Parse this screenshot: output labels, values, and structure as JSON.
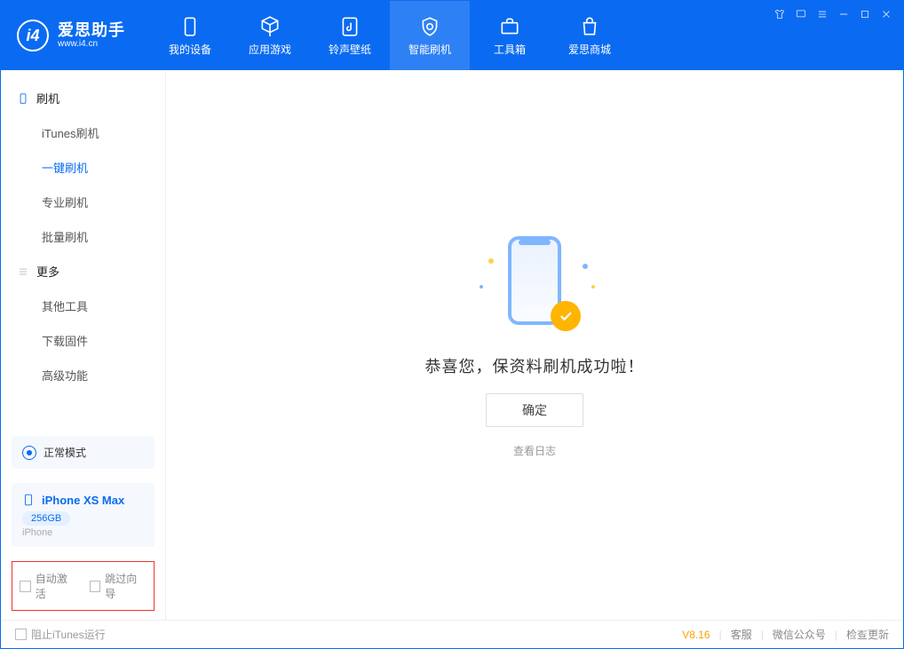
{
  "brand": {
    "cn": "爱思助手",
    "url": "www.i4.cn"
  },
  "nav": {
    "items": [
      {
        "label": "我的设备"
      },
      {
        "label": "应用游戏"
      },
      {
        "label": "铃声壁纸"
      },
      {
        "label": "智能刷机"
      },
      {
        "label": "工具箱"
      },
      {
        "label": "爱思商城"
      }
    ]
  },
  "sidebar": {
    "group1_title": "刷机",
    "group1_items": [
      {
        "label": "iTunes刷机"
      },
      {
        "label": "一键刷机"
      },
      {
        "label": "专业刷机"
      },
      {
        "label": "批量刷机"
      }
    ],
    "group2_title": "更多",
    "group2_items": [
      {
        "label": "其他工具"
      },
      {
        "label": "下载固件"
      },
      {
        "label": "高级功能"
      }
    ]
  },
  "device_status": {
    "label": "正常模式"
  },
  "device": {
    "name": "iPhone XS Max",
    "capacity": "256GB",
    "type": "iPhone"
  },
  "options": {
    "auto_activate": "自动激活",
    "skip_guide": "跳过向导"
  },
  "main": {
    "message": "恭喜您，保资料刷机成功啦！",
    "ok": "确定",
    "view_log": "查看日志"
  },
  "footer": {
    "block_itunes": "阻止iTunes运行",
    "version": "V8.16",
    "support": "客服",
    "wechat": "微信公众号",
    "check_update": "检查更新"
  }
}
